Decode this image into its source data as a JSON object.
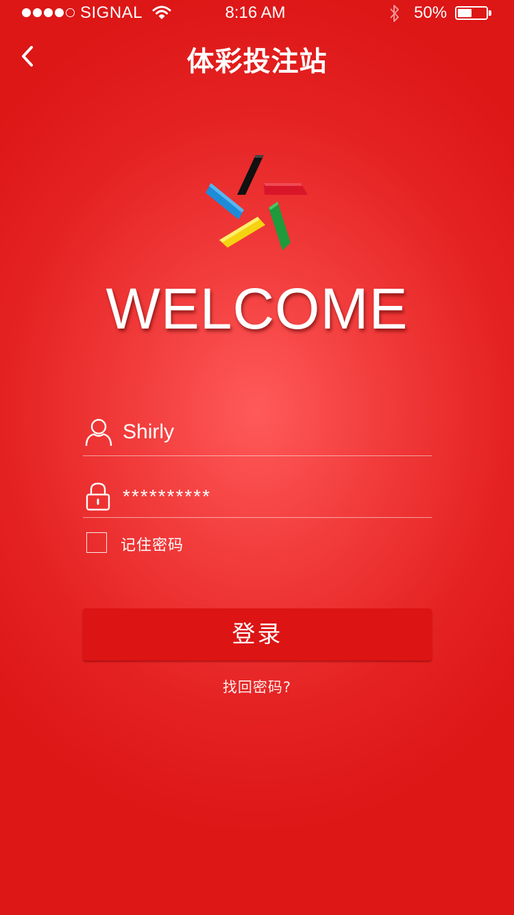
{
  "status_bar": {
    "carrier": "SIGNAL",
    "time": "8:16 AM",
    "battery_text": "50%",
    "battery_level": 0.5,
    "signal_strength": 4,
    "signal_max": 5,
    "icons": [
      "wifi-icon",
      "bluetooth-icon",
      "battery-icon"
    ]
  },
  "nav": {
    "back_icon": "chevron-left-icon",
    "title": "体彩投注站"
  },
  "logo": {
    "name": "lottery-star-logo",
    "colors": {
      "black": "#111111",
      "red": "#d9152a",
      "blue": "#1e8bd8",
      "green": "#1f9a3c",
      "yellow": "#f5d311"
    }
  },
  "welcome_text": "WELCOME",
  "form": {
    "username": {
      "icon": "user-icon",
      "value": "Shirly"
    },
    "password": {
      "icon": "lock-icon",
      "value": "**********"
    },
    "remember_label": "记住密码",
    "remember_checked": false,
    "login_label": "登录",
    "forgot_label": "找回密码?"
  },
  "colors": {
    "background": "#e52222",
    "button": "#dc1414",
    "text": "#ffffff"
  }
}
